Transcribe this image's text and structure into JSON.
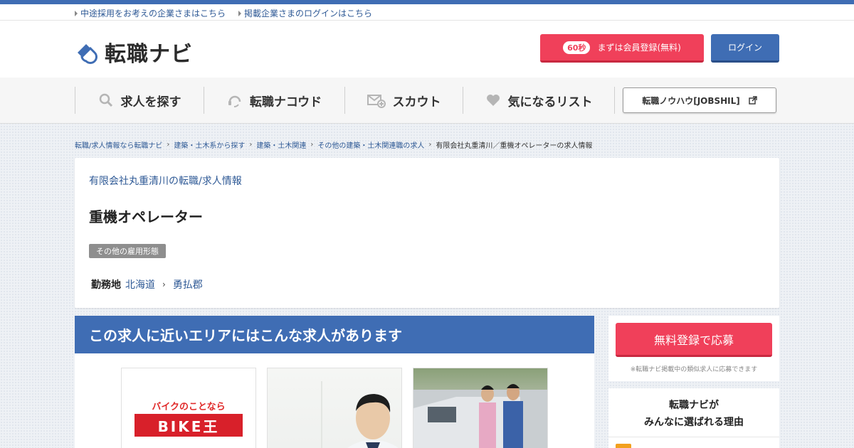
{
  "util_links": [
    "中途採用をお考えの企業さまはこちら",
    "掲載企業さまのログインはこちら"
  ],
  "logo": {
    "text": "転職ナビ"
  },
  "header": {
    "register_badge": "60秒",
    "register_label": "まずは会員登録(無料)",
    "login_label": "ログイン"
  },
  "nav": {
    "items": [
      {
        "label": "求人を探す",
        "icon": "search-icon"
      },
      {
        "label": "転職ナコウド",
        "icon": "headset-icon"
      },
      {
        "label": "スカウト",
        "icon": "mail-plus-icon"
      },
      {
        "label": "気になるリスト",
        "icon": "heart-icon"
      }
    ],
    "jobshil_label": "転職ノウハウ[JOBSHIL]"
  },
  "breadcrumb": {
    "items": [
      "転職/求人情報なら転職ナビ",
      "建築・土木系から探す",
      "建築・土木関連",
      "その他の建築・土木関連職の求人"
    ],
    "current": "有限会社丸重清川／重機オペレーターの求人情報"
  },
  "job": {
    "company_link": "有限会社丸重清川の転職/求人情報",
    "title": "重機オペレーター",
    "employment_type": "その他の雇用形態",
    "location_label": "勤務地",
    "location": [
      "北海道",
      "勇払郡"
    ]
  },
  "near": {
    "heading": "この求人に近いエリアにはこんな求人があります",
    "bike_tagline": "バイクのことなら",
    "bike_logo": "BIKE王"
  },
  "sidebar": {
    "apply_label": "無料登録で応募",
    "apply_note": "※転職ナビ掲載中の類似求人に応募できます",
    "reason_line1": "転職ナビが",
    "reason_line2": "みんなに選ばれる理由"
  },
  "colors": {
    "brand_blue": "#3f6db4",
    "accent_red": "#f0405a",
    "link_blue": "#2f5a96"
  }
}
